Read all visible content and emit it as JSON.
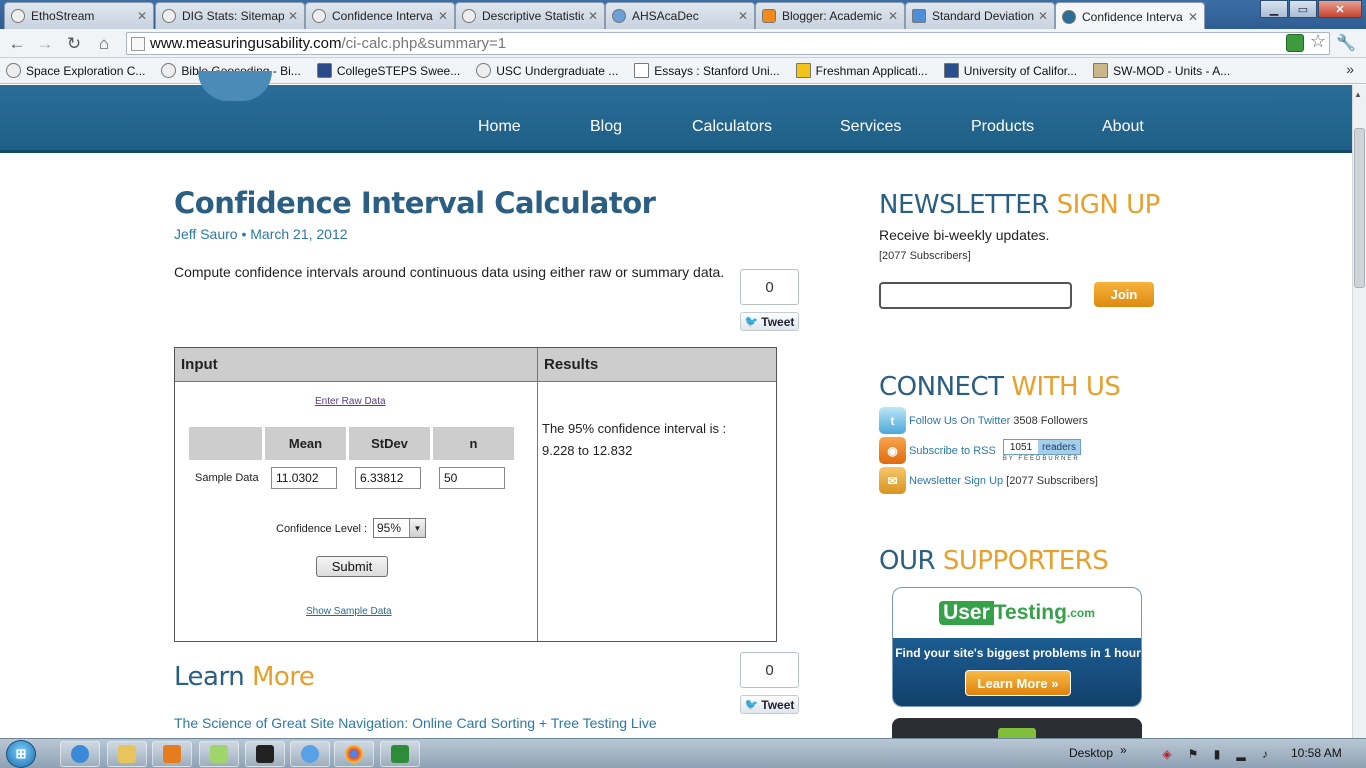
{
  "browser": {
    "tabs": [
      {
        "label": "EthoStream"
      },
      {
        "label": "DIG Stats: Sitemap"
      },
      {
        "label": "Confidence Interva"
      },
      {
        "label": "Descriptive Statistic"
      },
      {
        "label": "AHSAcaDec"
      },
      {
        "label": "Blogger: Academic"
      },
      {
        "label": "Standard Deviation"
      },
      {
        "label": "Confidence Interva"
      }
    ],
    "url_domain": "www.measuringusability.com",
    "url_path": "/ci-calc.php&summary=1",
    "bookmarks": [
      {
        "label": "Space Exploration C..."
      },
      {
        "label": "Bible Geocoding - Bi..."
      },
      {
        "label": "CollegeSTEPS Swee..."
      },
      {
        "label": "USC Undergraduate ..."
      },
      {
        "label": "Essays : Stanford Uni..."
      },
      {
        "label": "Freshman Applicati..."
      },
      {
        "label": "University of Califor..."
      },
      {
        "label": "SW-MOD - Units - A..."
      }
    ],
    "bookmarks_more": "»"
  },
  "site": {
    "nav": [
      {
        "label": "Home"
      },
      {
        "label": "Blog"
      },
      {
        "label": "Calculators"
      },
      {
        "label": "Services"
      },
      {
        "label": "Products"
      },
      {
        "label": "About"
      }
    ]
  },
  "article": {
    "title": "Confidence Interval Calculator",
    "byline": "Jeff Sauro • March 21, 2012",
    "intro": "Compute confidence intervals around continuous data using either raw or summary data.",
    "tweet_count": "0",
    "tweet_label": "Tweet"
  },
  "calculator": {
    "input_header": "Input",
    "results_header": "Results",
    "raw_link": "Enter Raw Data",
    "columns": [
      "Mean",
      "StDev",
      "n"
    ],
    "row_label": "Sample Data",
    "mean": "11.0302",
    "stdev": "6.33812",
    "n": "50",
    "confidence_label": "Confidence Level :",
    "confidence_value": "95%",
    "submit_label": "Submit",
    "sample_link": "Show Sample Data",
    "result_line1": "The 95% confidence interval is :",
    "result_line2": "9.228 to 12.832"
  },
  "learn": {
    "title_main": "Learn",
    "title_accent": "More",
    "tweet_count": "0",
    "tweet_label": "Tweet",
    "link": "The Science of Great Site Navigation: Online Card Sorting + Tree Testing Live"
  },
  "sidebar": {
    "newsletter_main": "NEWSLETTER",
    "newsletter_accent": "SIGN UP",
    "newsletter_sub": "Receive bi-weekly updates.",
    "newsletter_count": "[2077 Subscribers]",
    "join_label": "Join",
    "connect_main": "CONNECT",
    "connect_accent": "WITH US",
    "twitter_link": "Follow Us On Twitter",
    "twitter_count": "3508 Followers",
    "rss_link": "Subscribe to RSS",
    "rss_readers": "1051",
    "rss_readers_label": "readers",
    "rss_by": "BY FEEDBURNER",
    "newsletter_link": "Newsletter Sign Up",
    "newsletter_link_count": "[2077 Subscribers]",
    "supporters_main": "OUR",
    "supporters_accent": "SUPPORTERS",
    "ad_user": "User",
    "ad_testing": "Testing",
    "ad_com": ".com",
    "ad_tagline": "Find your site's biggest problems in 1 hour",
    "ad_button": "Learn More »"
  },
  "taskbar": {
    "desktop_label": "Desktop",
    "clock": "10:58 AM"
  },
  "colors": {
    "header_blue": "#2a6e98",
    "title_blue": "#2a5e82",
    "accent_orange": "#e8a02c",
    "link_blue": "#2c78a8"
  }
}
